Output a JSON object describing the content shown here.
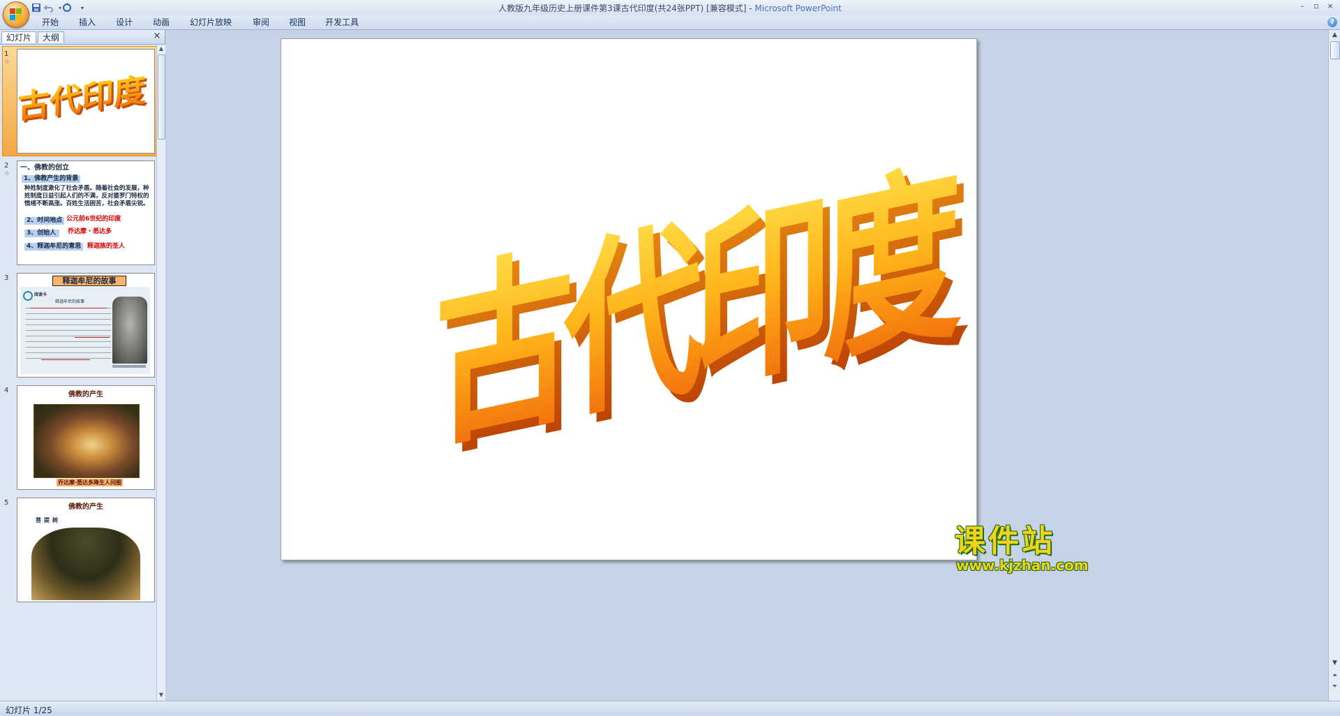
{
  "window": {
    "title": "人教版九年级历史上册课件第3课古代印度(共24张PPT) [兼容模式] - ",
    "app_name": "Microsoft PowerPoint"
  },
  "quick_access": {
    "save": "save-icon",
    "undo": "undo-icon",
    "redo": "redo-icon"
  },
  "ribbon": {
    "tabs": [
      "开始",
      "插入",
      "设计",
      "动画",
      "幻灯片放映",
      "审阅",
      "视图",
      "开发工具"
    ]
  },
  "pane": {
    "tabs": [
      "幻灯片",
      "大纲"
    ],
    "close": "×"
  },
  "thumbnails": [
    {
      "num": "1",
      "wordart": "古代印度"
    },
    {
      "num": "2",
      "heading": "一、佛教的创立",
      "item1": "1、佛教产生的背景",
      "para": "种姓制度激化了社会矛盾。随着社会的发展，种姓制度日益引起人们的不满，反对婆罗门特权的情绪不断高涨。百姓生活困苦，社会矛盾尖锐。",
      "item2": "2、时间地点",
      "item2_value": "公元前6世纪的印度",
      "item3": "3、创始人",
      "item3_value": "乔达摩・悉达多",
      "item4": "4、释迦牟尼的意思",
      "item4_value": "释迦族的圣人"
    },
    {
      "num": "3",
      "title": "释迦牟尼的故事",
      "card_title": "释迦牟尼的故事",
      "card_tag": "阅读卡"
    },
    {
      "num": "4",
      "title": "佛教的产生",
      "caption": "乔达摩·悉达多降生人间图"
    },
    {
      "num": "5",
      "title": "佛教的产生",
      "subtitle": "菩提树"
    }
  ],
  "slide": {
    "wordart": [
      "古",
      "代",
      "印",
      "度"
    ]
  },
  "status": {
    "text": "幻灯片 1/25"
  },
  "watermark": {
    "cn": "课件站",
    "url": "www.kjzhan.com"
  },
  "colors": {
    "accent_orange": "#f39a1e",
    "wordart_top": "#ffd21a",
    "wordart_side": "#e06a0a"
  }
}
